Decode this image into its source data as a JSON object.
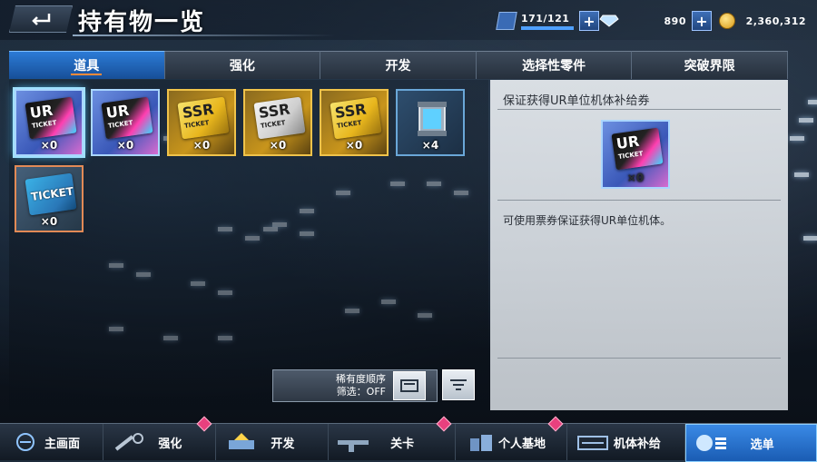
{
  "header": {
    "title": "持有物一览",
    "stamina": "171/121",
    "stamina_fill": 1.0,
    "gems": "890",
    "gold": "2,360,312"
  },
  "tabs": [
    {
      "label": "道具",
      "active": true
    },
    {
      "label": "强化",
      "active": false
    },
    {
      "label": "开发",
      "active": false
    },
    {
      "label": "选择性零件",
      "active": false
    },
    {
      "label": "突破界限",
      "active": false
    }
  ],
  "items": [
    {
      "kind": "ur",
      "ticket_text": "UR",
      "ticket_sub": "TICKET",
      "count": "×0",
      "selected": true
    },
    {
      "kind": "ur",
      "ticket_text": "UR",
      "ticket_sub": "TICKET",
      "count": "×0",
      "selected": false
    },
    {
      "kind": "ssr",
      "ticket_text": "SSR",
      "ticket_sub": "TICKET",
      "count": "×0",
      "selected": false
    },
    {
      "kind": "ssr2",
      "ticket_text": "SSR",
      "ticket_sub": "TICKET",
      "count": "×0",
      "selected": false
    },
    {
      "kind": "ssr",
      "ticket_text": "SSR",
      "ticket_sub": "TICKET",
      "count": "×0",
      "selected": false
    },
    {
      "kind": "part",
      "count": "×4",
      "selected": false
    },
    {
      "kind": "norm",
      "ticket_text": "TICKET",
      "count": "×0",
      "selected": false
    }
  ],
  "sort": {
    "line1": "稀有度顺序",
    "line2": "筛选：OFF"
  },
  "detail": {
    "title": "保证获得UR单位机体补给券",
    "ticket_text": "UR",
    "ticket_sub": "TICKET",
    "count": "×0",
    "description": "可使用票券保证获得UR单位机体。"
  },
  "nav": [
    {
      "label": "主画面",
      "icon": "home-icon",
      "badge": false,
      "active": false
    },
    {
      "label": "强化",
      "icon": "wrench-icon",
      "badge": true,
      "active": false
    },
    {
      "label": "开发",
      "icon": "develop-icon",
      "badge": false,
      "active": false
    },
    {
      "label": "关卡",
      "icon": "rifle-icon",
      "badge": true,
      "active": false
    },
    {
      "label": "个人基地",
      "icon": "base-icon",
      "badge": true,
      "active": false
    },
    {
      "label": "机体补给",
      "icon": "supply-icon",
      "badge": false,
      "active": false
    },
    {
      "label": "选单",
      "icon": "menu-icon",
      "badge": false,
      "active": true
    }
  ],
  "colors": {
    "accent_blue": "#2c7bd6",
    "badge_pink": "#e8407e",
    "tab_underline": "#ff8a3a"
  }
}
